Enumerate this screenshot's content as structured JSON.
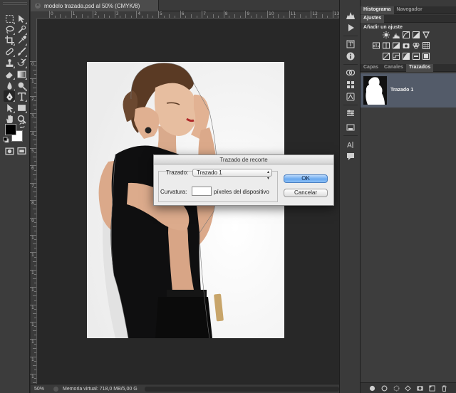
{
  "document": {
    "tab_title": "modelo trazada.psd al 50% (CMYK/8)",
    "close_glyph": "×"
  },
  "rulers": {
    "top_labels": [
      "0",
      "1",
      "2",
      "3",
      "4",
      "5",
      "6",
      "7",
      "8",
      "9",
      "10",
      "11",
      "12",
      "13"
    ],
    "left_labels": [
      "0",
      "1",
      "2",
      "3",
      "4",
      "5",
      "6",
      "7",
      "8",
      "9",
      "1",
      "1",
      "1",
      "1",
      "1",
      "1",
      "1",
      "1",
      "1",
      "1"
    ]
  },
  "status_bar": {
    "zoom": "50%",
    "info": "Memoria virtual: 718,0 MB/5,00 G"
  },
  "panels": {
    "top_tabs": [
      "Histograma",
      "Navegador"
    ],
    "adjust_tab": "Ajustes",
    "adjust_title": "Añadir un ajuste",
    "layer_tabs": [
      "Capas",
      "Canales",
      "Trazados"
    ],
    "path_name": "Trazado 1"
  },
  "dialog": {
    "title": "Trazado de recorte",
    "path_label": "Trazado:",
    "path_value": "Trazado 1",
    "flatness_label": "Curvatura:",
    "flatness_value": "",
    "units_label": "píxeles del dispositivo",
    "ok_label": "OK",
    "cancel_label": "Cancelar"
  },
  "colors": {
    "foreground": "#000000",
    "background": "#ffffff",
    "selected_path_row": "#535b69",
    "ok_accent": "#6aa9ef"
  },
  "icons": {
    "tools": [
      "marquee-tool-icon",
      "move-tool-icon",
      "lasso-tool-icon",
      "quick-select-tool-icon",
      "crop-tool-icon",
      "eyedropper-tool-icon",
      "healing-brush-tool-icon",
      "brush-tool-icon",
      "clone-stamp-tool-icon",
      "history-brush-tool-icon",
      "eraser-tool-icon",
      "gradient-tool-icon",
      "blur-tool-icon",
      "dodge-tool-icon",
      "pen-tool-icon",
      "type-tool-icon",
      "path-selection-tool-icon",
      "shape-tool-icon",
      "hand-tool-icon",
      "zoom-tool-icon"
    ]
  }
}
